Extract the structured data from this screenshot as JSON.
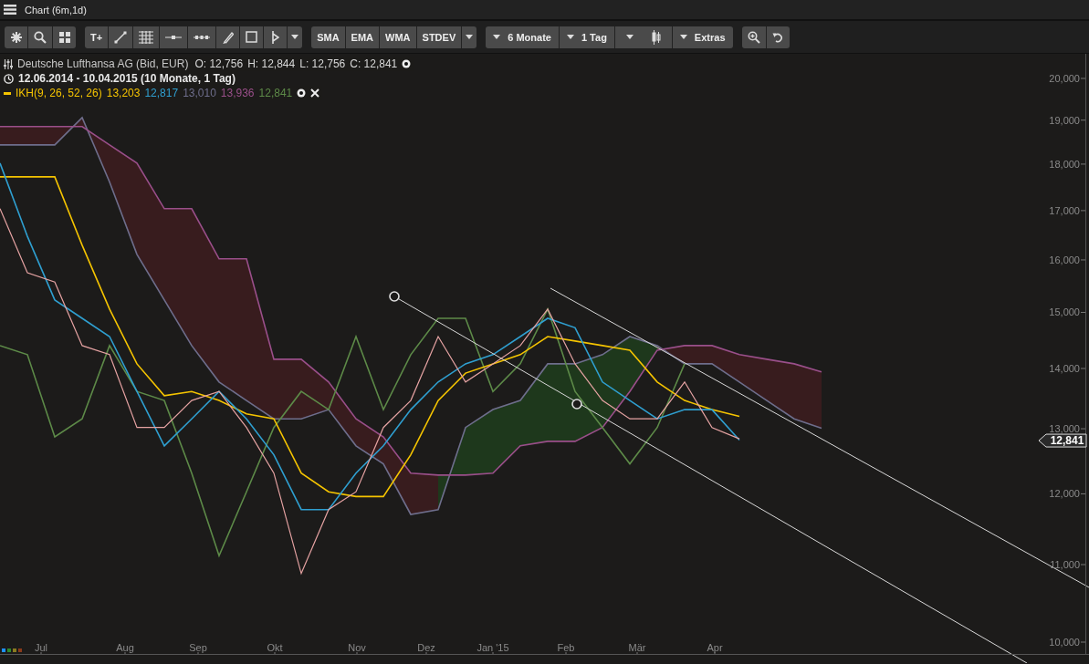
{
  "window": {
    "title": "Chart (6m,1d)"
  },
  "toolbar": {
    "text_tool": {
      "label": "T+"
    },
    "indicator_buttons": [
      {
        "label": "SMA"
      },
      {
        "label": "EMA"
      },
      {
        "label": "WMA"
      },
      {
        "label": "STDEV"
      }
    ],
    "period_dropdown": {
      "label": "6 Monate"
    },
    "interval_dropdown": {
      "label": "1 Tag"
    },
    "extras_dropdown": {
      "label": "Extras"
    }
  },
  "legend": {
    "instrument": "Deutsche Lufthansa AG (Bid, EUR)",
    "quotes": [
      "O: 12,756",
      "H: 12,844",
      "L: 12,756",
      "C: 12,841"
    ],
    "range": "12.06.2014 - 10.04.2015 (10 Monate, 1 Tag)",
    "indicator": {
      "label": "IKH(9, 26, 52, 26)",
      "color": "#f5c400",
      "values": [
        {
          "text": "13,203",
          "color": "#f5c400"
        },
        {
          "text": "12,817",
          "color": "#2f9fd0"
        },
        {
          "text": "13,010",
          "color": "#6e6e8c"
        },
        {
          "text": "13,936",
          "color": "#9a4f8a"
        },
        {
          "text": "12,841",
          "color": "#5d8a48"
        }
      ]
    }
  },
  "price_axis": [
    "20,000",
    "19,000",
    "18,000",
    "17,000",
    "16,000",
    "15,000",
    "14,000",
    "13,000",
    "12,000",
    "11,000",
    "10,000"
  ],
  "time_axis": [
    "Jul",
    "Aug",
    "Sep",
    "Okt",
    "Nov",
    "Dez",
    "Jan '15",
    "Feb",
    "Mär",
    "Apr"
  ],
  "price_marker": "12,841",
  "swatches": [
    {
      "color": "#1e90ff"
    },
    {
      "color": "#2e8b2e"
    },
    {
      "color": "#8a7a20"
    },
    {
      "color": "#8b3a1a"
    }
  ]
}
